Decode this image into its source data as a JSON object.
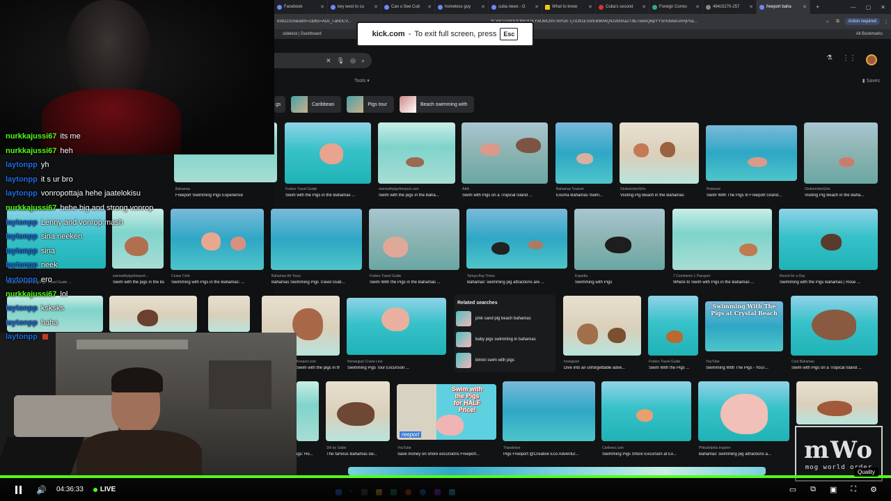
{
  "browser": {
    "tabs": [
      {
        "label": "Facebook"
      },
      {
        "label": "key west to cu"
      },
      {
        "label": "Can u See Cub"
      },
      {
        "label": "homeless guy"
      },
      {
        "label": "cuba news - G"
      },
      {
        "label": "What to know"
      },
      {
        "label": "Cuba's second"
      },
      {
        "label": "Foreign Corres"
      },
      {
        "label": "464c5270-257"
      },
      {
        "label": "freeport baha"
      }
    ],
    "url": "83922316&udm=2&fbs=ADc_l-aN0CV...",
    "url_tail": "3Cx9QZu9I3QQhR3OEYwUkKzmr7kPOd-TjTiO91ES5fEBbM4Q42vkNXa2TlbLTwe5QBpYYSrXil5beUAHjPva...",
    "action_required": "Action required",
    "bookmark_left": "sidekick | Dashboard",
    "bookmark_right": "All Bookmarks"
  },
  "fullscreen_toast": {
    "site": "kick.com",
    "message": "To exit full screen, press",
    "key": "Esc"
  },
  "google": {
    "tools_label": "Tools",
    "saves_label": "Saves",
    "chips": [
      {
        "label": "gs"
      },
      {
        "label": "Caribbean"
      },
      {
        "label": "Pigs tour"
      },
      {
        "label": "Beach swimming with"
      }
    ],
    "row1": [
      {
        "source": "Bahamas",
        "caption": "Freeport Swimming Pigs Experience"
      },
      {
        "source": "Fodors Travel Guide",
        "caption": "Swim with the Pigs in the Bahamas ..."
      },
      {
        "source": "swimwithpigsfreeport.com",
        "caption": "Swim with the pigs in the Baha..."
      },
      {
        "source": "AAA",
        "caption": "Swim with Pigs on a Tropical Island ..."
      },
      {
        "source": "Bahamas Tourism",
        "caption": "Exuma Bahamas Swim..."
      },
      {
        "source": "GlobetrotterGirls",
        "caption": "Visiting Pig Beach in the Bahamas"
      },
      {
        "source": "Pinterest",
        "caption": "Swim With The Pigs In Freeport Grand..."
      },
      {
        "source": "GlobetrotterGirls",
        "caption": "Visiting Pig Beach in the Baha..."
      }
    ],
    "row2": [
      {
        "source": "Bahamas Swimming Pigs Travel Guide ...",
        "caption": ""
      },
      {
        "source": "swimwithpigsfreeport...",
        "caption": "Swim with the pigs in the Baha..."
      },
      {
        "source": "Cruise Critic",
        "caption": "Swimming with Pigs in the Bahamas: ..."
      },
      {
        "source": "Bahamas Air Tours",
        "caption": "Bahamas Swimming Pigs Travel Guid..."
      },
      {
        "source": "Fodors Travel Guide",
        "caption": "Swim With the Pigs in the Bahamas ..."
      },
      {
        "source": "Tampa Bay Times",
        "caption": "Bahamas' swimming pig attractions are ..."
      },
      {
        "source": "Expedia",
        "caption": "Swimming with Pigs"
      },
      {
        "source": "7 Continents 1 Passport",
        "caption": "Where to Swim with Pigs in the Bahamas ..."
      },
      {
        "source": "Resort for a Day",
        "caption": "Swimming with the Pigs Bahamas | Rose ..."
      }
    ],
    "row3": [
      {
        "source": "freeport.com",
        "caption": "Swim with the pigs in the Baha..."
      },
      {
        "source": "Norwegian Cruise Line",
        "caption": "Swimming Pigs Tour Excursion ..."
      },
      {
        "source": "Instagram",
        "caption": "Dive into an unforgettable adve..."
      },
      {
        "source": "Fodors Travel Guide",
        "caption": "Swim With the Pigs ..."
      },
      {
        "source": "YouTube",
        "caption": "Swimming With The Pigs - YouT..."
      },
      {
        "source": "Cool Bahamas",
        "caption": "Swim with Pigs on a Tropical Island ..."
      }
    ],
    "row3_overlay_text": "Swimming With The Pigs at Crystal Beach",
    "related": {
      "title": "Related searches",
      "items": [
        {
          "label": "pink sand pig beach bahamas"
        },
        {
          "label": "baby pigs swimming in bahamas"
        },
        {
          "label": "bimini swim with pigs"
        }
      ]
    },
    "row4": [
      {
        "source": "",
        "caption": "igs: Ho..."
      },
      {
        "source": "Sth by Sadie",
        "caption": "The famous Bahamas sw..."
      },
      {
        "source": "YouTube",
        "caption": "Save money on shore excursions Freeport..."
      },
      {
        "source": "Tripadvisor",
        "caption": "Pigs Freeport @Creative Eco Adventur..."
      },
      {
        "source": "Caribeez.com",
        "caption": "Swimming Pigs Shore Excursion at Ex..."
      },
      {
        "source": "Philadelphia Inquirer",
        "caption": "Bahamas' swimming pig attractions a..."
      }
    ],
    "thumb_text": {
      "line1": "Swim with",
      "line2": "the Pigs",
      "line3": "for HALF",
      "line4": "Price!",
      "tag": "reeport"
    }
  },
  "chat": [
    {
      "user": "nurkkajussi67",
      "color": "green",
      "message": "its me"
    },
    {
      "user": "nurkkajussi67",
      "color": "green",
      "message": "heh"
    },
    {
      "user": "laytonpp",
      "color": "blue",
      "message": "yh"
    },
    {
      "user": "laytonpp",
      "color": "blue",
      "message": "it s ur bro"
    },
    {
      "user": "laytonpp",
      "color": "blue",
      "message": "vonropottaja hehe jaatelokisu"
    },
    {
      "user": "nurkkajussi67",
      "color": "green",
      "message": "hehe big and strong vonrop"
    },
    {
      "user": "laytonpp",
      "color": "blue",
      "message": "Lenny and vonrop mash"
    },
    {
      "user": "laytonpp",
      "color": "blue",
      "message": "sina neeken"
    },
    {
      "user": "laytonpp",
      "color": "blue",
      "message": "sina"
    },
    {
      "user": "laytonpp",
      "color": "blue",
      "message": "neek"
    },
    {
      "user": "laytonpp",
      "color": "blue",
      "message": "ero"
    },
    {
      "user": "nurkkajussi67",
      "color": "green",
      "message": "lol"
    },
    {
      "user": "laytonpp",
      "color": "blue",
      "message": "ksksks"
    },
    {
      "user": "laytonpp",
      "color": "blue",
      "message": "haha"
    },
    {
      "user": "laytonpp",
      "color": "blue",
      "message": ""
    }
  ],
  "player": {
    "time": "04:36:33",
    "live_label": "LIVE",
    "quality_tooltip": "Quality",
    "accent": "#53fc18"
  },
  "logo": {
    "main": "mWo",
    "sub": "mog world order"
  }
}
